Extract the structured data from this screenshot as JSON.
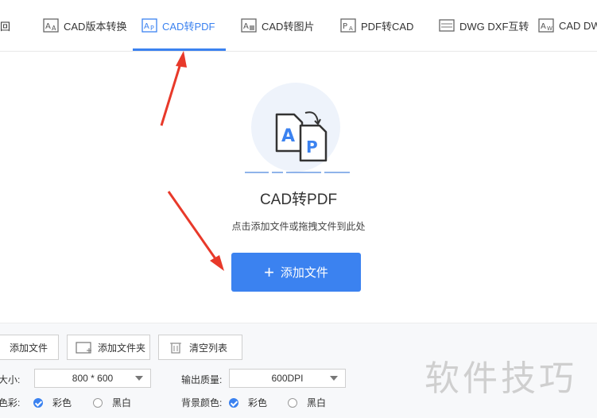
{
  "tabs": [
    {
      "label": "回",
      "active": false
    },
    {
      "label": "CAD版本转换",
      "active": false
    },
    {
      "label": "CAD转PDF",
      "active": true
    },
    {
      "label": "CAD转图片",
      "active": false
    },
    {
      "label": "PDF转CAD",
      "active": false
    },
    {
      "label": "DWG DXF互转",
      "active": false
    },
    {
      "label": "CAD DWF",
      "active": false
    }
  ],
  "main": {
    "title": "CAD转PDF",
    "hint": "点击添加文件或拖拽文件到此处",
    "add_button": "添加文件"
  },
  "toolbar": {
    "add_file": "添加文件",
    "add_folder": "添加文件夹",
    "clear_list": "清空列表"
  },
  "settings": {
    "size_label": "大小:",
    "size_value": "800 * 600",
    "quality_label": "输出质量:",
    "quality_value": "600DPI",
    "color_label": "色彩:",
    "color_opt_color": "彩色",
    "color_opt_bw": "黑白",
    "color_selected": "彩色",
    "bg_label": "背景颜色:",
    "bg_opt_color": "彩色",
    "bg_opt_bw": "黑白",
    "bg_selected": "彩色"
  },
  "watermark": "软件技巧",
  "colors": {
    "accent": "#3b82f0",
    "annotation_arrow": "#e8392a"
  }
}
